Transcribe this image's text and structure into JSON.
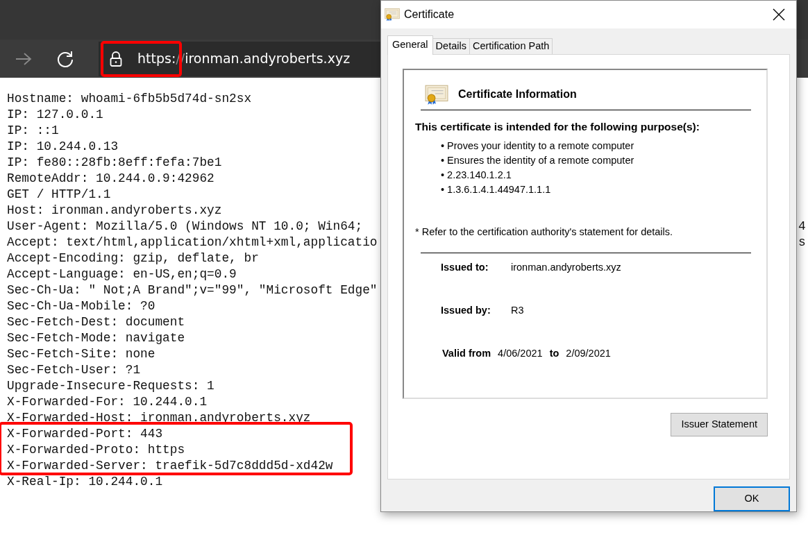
{
  "browser": {
    "forward_disabled": true,
    "url_parts": [
      {
        "text": "https:",
        "dim": false
      },
      {
        "text": "//",
        "dim": true
      },
      {
        "text": "ironman.andyroberts.xyz",
        "dim": false
      }
    ]
  },
  "page_lines": [
    {
      "text": "Hostname: whoami-6fb5b5d74d-sn2sx"
    },
    {
      "text": "IP: 127.0.0.1"
    },
    {
      "text": "IP: ::1"
    },
    {
      "text": "IP: 10.244.0.13"
    },
    {
      "text": "IP: fe80::28fb:8eff:fefa:7be1"
    },
    {
      "text": "RemoteAddr: 10.244.0.9:42962"
    },
    {
      "text": "GET / HTTP/1.1"
    },
    {
      "text": "Host: ironman.andyroberts.xyz"
    },
    {
      "text": "User-Agent: Mozilla/5.0 (Windows NT 10.0; Win64;",
      "tail": "4"
    },
    {
      "text": "Accept: text/html,application/xhtml+xml,applicatio",
      "tail": "s"
    },
    {
      "text": "Accept-Encoding: gzip, deflate, br"
    },
    {
      "text": "Accept-Language: en-US,en;q=0.9"
    },
    {
      "text": "Sec-Ch-Ua: \" Not;A Brand\";v=\"99\", \"Microsoft Edge\""
    },
    {
      "text": "Sec-Ch-Ua-Mobile: ?0"
    },
    {
      "text": "Sec-Fetch-Dest: document"
    },
    {
      "text": "Sec-Fetch-Mode: navigate"
    },
    {
      "text": "Sec-Fetch-Site: none"
    },
    {
      "text": "Sec-Fetch-User: ?1"
    },
    {
      "text": "Upgrade-Insecure-Requests: 1"
    },
    {
      "text": "X-Forwarded-For: 10.244.0.1"
    },
    {
      "text": "X-Forwarded-Host: ironman.andyroberts.xyz"
    },
    {
      "text": "X-Forwarded-Port: 443"
    },
    {
      "text": "X-Forwarded-Proto: https"
    },
    {
      "text": "X-Forwarded-Server: traefik-5d7c8ddd5d-xd42w"
    },
    {
      "text": "X-Real-Ip: 10.244.0.1"
    }
  ],
  "dialog": {
    "title": "Certificate",
    "tabs": [
      {
        "label": "General",
        "selected": true
      },
      {
        "label": "Details",
        "selected": false
      },
      {
        "label": "Certification Path",
        "selected": false
      }
    ],
    "heading": "Certificate Information",
    "purpose_title": "This certificate is intended for the following purpose(s):",
    "purposes": [
      {
        "bullet": "•",
        "text": "Proves your identity to a remote computer"
      },
      {
        "bullet": "•",
        "text": "Ensures the identity of a remote computer"
      },
      {
        "bullet": "•",
        "text": "2.23.140.1.2.1"
      },
      {
        "bullet": "•",
        "text": "1.3.6.1.4.1.44947.1.1.1"
      }
    ],
    "note": "* Refer to the certification authority's statement for details.",
    "fields": [
      {
        "label": "Issued to:",
        "value": "ironman.andyroberts.xyz"
      },
      {
        "label": "Issued by:",
        "value": "R3"
      }
    ],
    "validity": {
      "from_label": "Valid from",
      "from": "4/06/2021",
      "to_label": "to",
      "to": "2/09/2021"
    },
    "buttons": {
      "issuer": "Issuer Statement",
      "ok": "OK"
    }
  }
}
